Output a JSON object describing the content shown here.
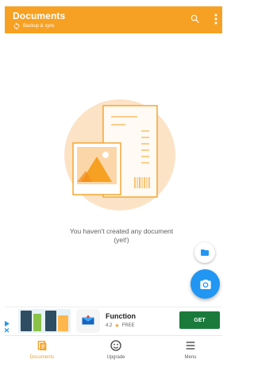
{
  "appbar": {
    "title": "Documents",
    "subtitle": "Backup & sync",
    "color": "#f6a123"
  },
  "empty_state": {
    "message": "You haven't created any document (yet!)"
  },
  "fabs": {
    "folder_icon": "folder-icon",
    "camera_icon": "camera-icon",
    "primary_color": "#2196f3"
  },
  "ad": {
    "app_name": "Function",
    "rating": "4.2",
    "price": "FREE",
    "cta": "GET",
    "cta_color": "#1a7a3c"
  },
  "bottom_nav": {
    "items": [
      {
        "label": "Documents",
        "icon": "documents-icon",
        "active": true
      },
      {
        "label": "Upgrade",
        "icon": "smiley-icon",
        "active": false
      },
      {
        "label": "Menu",
        "icon": "menu-icon",
        "active": false
      }
    ]
  }
}
